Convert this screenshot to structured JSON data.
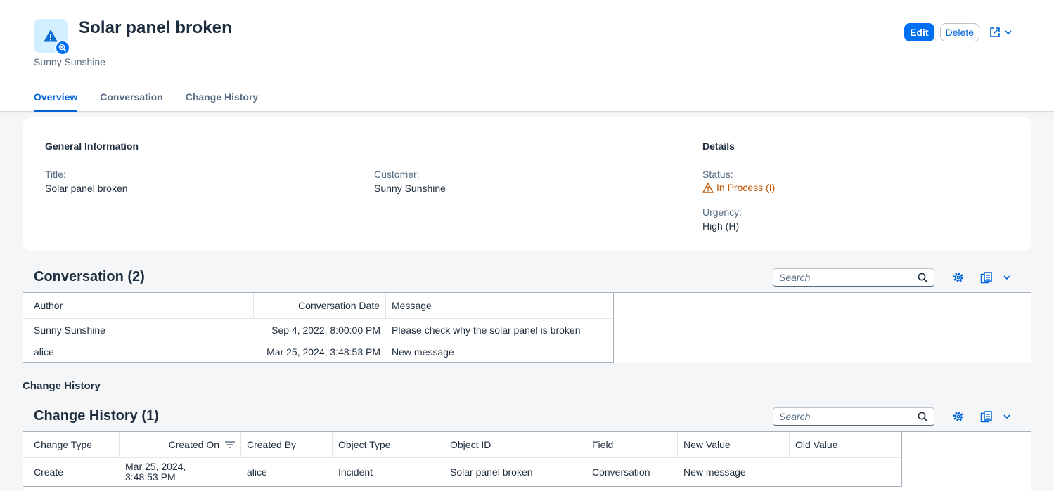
{
  "header": {
    "title": "Solar panel broken",
    "subtitle": "Sunny Sunshine",
    "actions": {
      "edit": "Edit",
      "delete": "Delete"
    },
    "tabs": [
      "Overview",
      "Conversation",
      "Change History"
    ],
    "active_tab": "Overview",
    "avatar_icon": "warning-icon",
    "accent": "#0070f2"
  },
  "general": {
    "heading": "General Information",
    "title_label": "Title:",
    "title_value": "Solar panel broken",
    "customer_label": "Customer:",
    "customer_value": "Sunny Sunshine"
  },
  "details": {
    "heading": "Details",
    "status_label": "Status:",
    "status_value": "In Process (I)",
    "status_color": "#c35500",
    "urgency_label": "Urgency:",
    "urgency_value": "High (H)"
  },
  "conversation": {
    "title": "Conversation (2)",
    "search_placeholder": "Search",
    "columns": [
      "Author",
      "Conversation Date",
      "Message"
    ],
    "rows": [
      {
        "author": "Sunny Sunshine",
        "date": "Sep 4, 2022, 8:00:00 PM",
        "message": "Please check why the solar panel is broken"
      },
      {
        "author": "alice",
        "date": "Mar 25, 2024, 3:48:53 PM",
        "message": "New message"
      }
    ]
  },
  "change_history": {
    "section_label": "Change History",
    "title": "Change History (1)",
    "search_placeholder": "Search",
    "columns": [
      "Change Type",
      "Created On",
      "Created By",
      "Object Type",
      "Object ID",
      "Field",
      "New Value",
      "Old Value"
    ],
    "rows": [
      {
        "change_type": "Create",
        "created_on_1": "Mar 25, 2024,",
        "created_on_2": "3:48:53 PM",
        "created_by": "alice",
        "object_type": "Incident",
        "object_id": "Solar panel broken",
        "field": "Conversation",
        "new_value": "New message",
        "old_value": ""
      }
    ]
  }
}
